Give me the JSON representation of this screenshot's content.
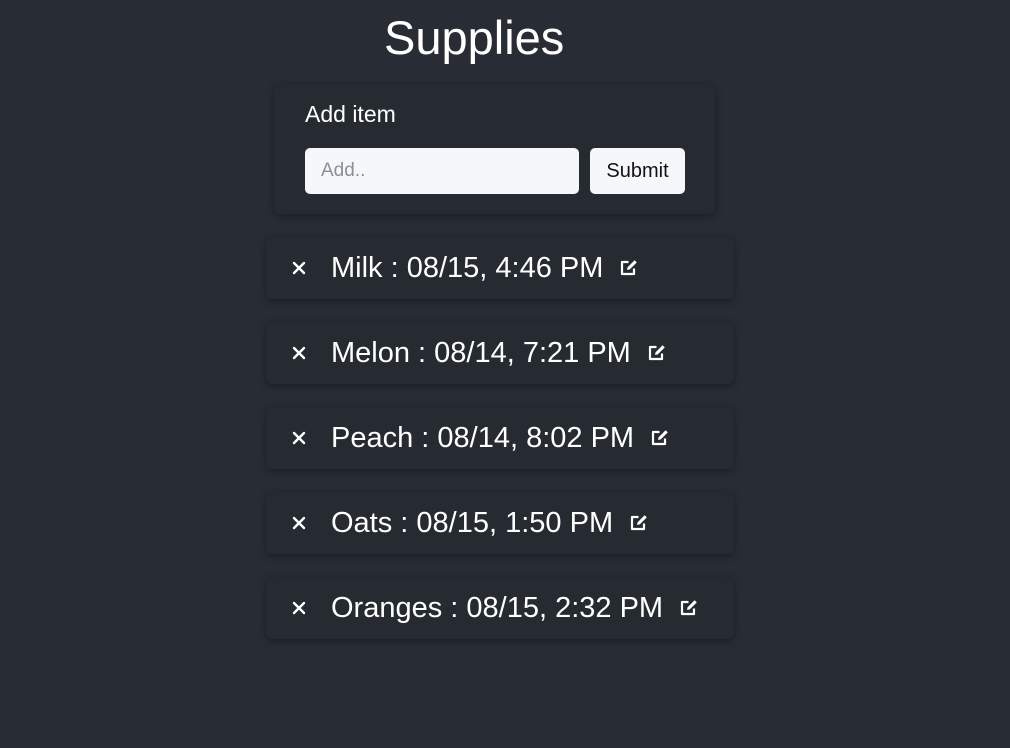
{
  "page": {
    "title": "Supplies"
  },
  "add_form": {
    "label": "Add item",
    "input_value": "",
    "input_placeholder": "Add..",
    "submit_label": "Submit"
  },
  "items": [
    {
      "text": "Milk : 08/15, 4:46 PM",
      "delete_icon": "close-icon",
      "edit_icon": "edit-icon"
    },
    {
      "text": "Melon : 08/14, 7:21 PM",
      "delete_icon": "close-icon",
      "edit_icon": "edit-icon"
    },
    {
      "text": "Peach : 08/14, 8:02 PM",
      "delete_icon": "close-icon",
      "edit_icon": "edit-icon"
    },
    {
      "text": "Oats : 08/15, 1:50 PM",
      "delete_icon": "close-icon",
      "edit_icon": "edit-icon"
    },
    {
      "text": "Oranges : 08/15, 2:32 PM",
      "delete_icon": "close-icon",
      "edit_icon": "edit-icon"
    }
  ],
  "colors": {
    "background": "#282c34",
    "card": "#262a31",
    "text": "#ffffff",
    "input_bg": "#f5f7fa"
  }
}
